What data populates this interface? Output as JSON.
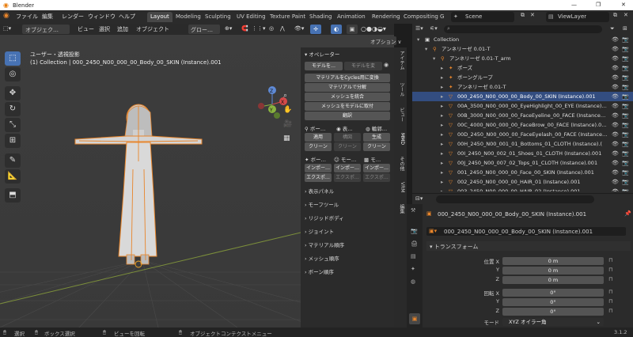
{
  "window": {
    "title": "Blender",
    "controls": [
      "—",
      "❐",
      "✕"
    ]
  },
  "menubar": {
    "items": [
      "ファイル",
      "編集",
      "レンダー",
      "ウィンドウ",
      "ヘルプ"
    ]
  },
  "workspaces": {
    "tabs": [
      "Layout",
      "Modeling",
      "Sculpting",
      "UV Editing",
      "Texture Paint",
      "Shading",
      "Animation",
      "Rendering",
      "Compositing",
      "G"
    ],
    "active": "Layout"
  },
  "scene": {
    "label": "Scene",
    "viewlayer": "ViewLayer"
  },
  "viewport_header": {
    "mode": "オブジェク…",
    "menus": [
      "ビュー",
      "選択",
      "追加",
      "オブジェクト"
    ],
    "orientation": "グロー…",
    "options": "オプション ∨"
  },
  "viewport": {
    "view_name": "ユーザー・透視投影",
    "collection_info": "(1) Collection | 000_2450_N00_000_00_Body_00_SKIN (Instance).001"
  },
  "gizmo": {
    "z": "Z",
    "x": "X",
    "y": "Y"
  },
  "npanel": {
    "header": "オペレーター",
    "btn_model_a": "モデルを…",
    "btn_model_b": "モデルを変",
    "btn_cycles": "マテリアルをCycles用に変換",
    "btn_split": "マテリアルで分解",
    "btn_merge": "メッシュを統合",
    "btn_separate": "メッシュをモデルに取付",
    "btn_translate": "翻訳",
    "section_bone": "ボー…",
    "section_display": "表…",
    "section_outline": "輪郭…",
    "apply": "適用",
    "apply2": "構図",
    "generate": "生成",
    "clean": "クリーン",
    "clean2": "クリーン",
    "clean3": "クリーン",
    "bone_row": [
      "ボー…",
      "モー…",
      "モ…"
    ],
    "import": [
      "インポー…",
      "インポー…",
      "インポー…"
    ],
    "export": [
      "エクスポ…",
      "エクスポ…",
      "エクスポ…"
    ],
    "panels": [
      "表示パネル",
      "モーフツール",
      "リジッドボディ",
      "ジョイント",
      "マテリアル順序",
      "メッシュ順序",
      "ボーン順序"
    ]
  },
  "vtabs": [
    "アイテム",
    "ツール",
    "ビュー",
    "MMD",
    "その他",
    "VRM",
    "編集"
  ],
  "outliner": {
    "search_placeholder": "",
    "rows": [
      {
        "indent": 0,
        "name": "Collection",
        "icon": "▣",
        "selected": false
      },
      {
        "indent": 1,
        "name": "アンネリーゼ 0.01-T",
        "icon": "⚲",
        "selected": false
      },
      {
        "indent": 2,
        "name": "アンネリーゼ 0.01-T_arm",
        "icon": "⚲",
        "selected": false
      },
      {
        "indent": 3,
        "name": "ポーズ",
        "icon": "✦",
        "selected": false
      },
      {
        "indent": 3,
        "name": "ボーングループ",
        "icon": "✦",
        "selected": false
      },
      {
        "indent": 3,
        "name": "アンネリーゼ 0.01-T",
        "icon": "✦",
        "selected": false
      },
      {
        "indent": 3,
        "name": "000_2450_N00_000_00_Body_00_SKIN (Instance).001",
        "icon": "▽",
        "selected": true
      },
      {
        "indent": 3,
        "name": "00A_3500_N00_000_00_EyeHighlight_00_EYE (Instance)…",
        "icon": "▽",
        "selected": false
      },
      {
        "indent": 3,
        "name": "00B_3000_N00_000_00_FaceEyeline_00_FACE (Instance…",
        "icon": "▽",
        "selected": false
      },
      {
        "indent": 3,
        "name": "00C_4000_N00_000_00_FaceBrow_00_FACE (Instance).0…",
        "icon": "▽",
        "selected": false
      },
      {
        "indent": 3,
        "name": "00D_2450_N00_000_00_FaceEyelash_00_FACE (Instance…",
        "icon": "▽",
        "selected": false
      },
      {
        "indent": 3,
        "name": "00H_2450_N00_001_01_Bottoms_01_CLOTH (Instance).(",
        "icon": "▽",
        "selected": false
      },
      {
        "indent": 3,
        "name": "00I_2450_N00_002_01_Shoes_01_CLOTH (Instance).001",
        "icon": "▽",
        "selected": false
      },
      {
        "indent": 3,
        "name": "00J_2450_N00_007_02_Tops_01_CLOTH (Instance).001",
        "icon": "▽",
        "selected": false
      },
      {
        "indent": 3,
        "name": "001_2450_N00_000_00_Face_00_SKIN (Instance).001",
        "icon": "▽",
        "selected": false
      },
      {
        "indent": 3,
        "name": "002_2450_N00_000_00_HAIR_01 (Instance).001",
        "icon": "▽",
        "selected": false
      },
      {
        "indent": 3,
        "name": "003_2450_N00_000_00_HAIR_02 (Instance).001",
        "icon": "▽",
        "selected": false
      }
    ]
  },
  "properties": {
    "object_name": "000_2450_N00_000_00_Body_00_SKIN (Instance).001",
    "data_name": "000_2450_N00_000_00_Body_00_SKIN (Instance).001",
    "section": "トランスフォーム",
    "location_label": "位置 X",
    "loc_y_label": "Y",
    "loc_z_label": "Z",
    "location": [
      "0 m",
      "0 m",
      "0 m"
    ],
    "rotation_label": "回転 X",
    "rot_y_label": "Y",
    "rot_z_label": "Z",
    "rotation": [
      "0°",
      "0°",
      "0°"
    ],
    "mode_label": "モード",
    "mode_value": "XYZ オイラー角"
  },
  "statusbar": {
    "select": "選択",
    "box": "ボックス選択",
    "rotate": "ビューを回転",
    "context": "オブジェクトコンテクストメニュー",
    "version": "3.1.2"
  },
  "colors": {
    "accent": "#4772b3",
    "selection": "#334d80",
    "orange": "#e8852b"
  }
}
